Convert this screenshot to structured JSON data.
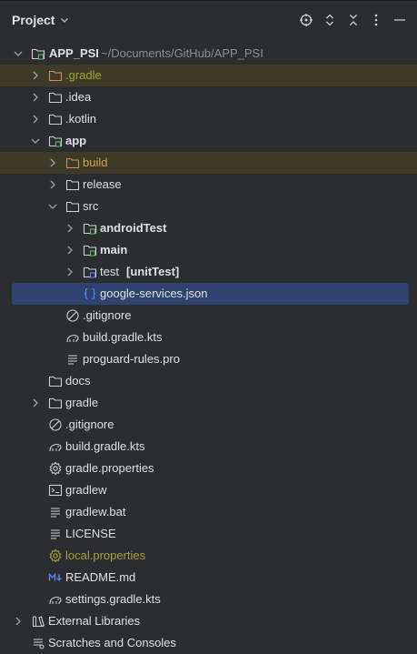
{
  "header": {
    "title": "Project",
    "tools": [
      "target-icon",
      "expand-icon",
      "collapse-icon",
      "more-icon",
      "minimize-icon"
    ]
  },
  "tree": {
    "root": {
      "name": "APP_PSI",
      "path": "~/Documents/GitHub/APP_PSI"
    },
    "gradle_dir": ".gradle",
    "idea_dir": ".idea",
    "kotlin_dir": ".kotlin",
    "app": {
      "name": "app",
      "build": "build",
      "release": "release",
      "src": {
        "name": "src",
        "android_test": "androidTest",
        "main": "main",
        "test": "test",
        "test_tag": "[unitTest]"
      },
      "google_services": "google-services.json",
      "gitignore": ".gitignore",
      "build_gradle": "build.gradle.kts",
      "proguard": "proguard-rules.pro"
    },
    "docs": "docs",
    "gradle": "gradle",
    "gitignore": ".gitignore",
    "build_gradle": "build.gradle.kts",
    "gradle_properties": "gradle.properties",
    "gradlew": "gradlew",
    "gradlew_bat": "gradlew.bat",
    "license": "LICENSE",
    "local_properties": "local.properties",
    "readme": "README.md",
    "settings_gradle": "settings.gradle.kts",
    "external_libraries": "External Libraries",
    "scratches": "Scratches and Consoles"
  },
  "colors": {
    "background": "#2b2d30",
    "selection": "#2e436e",
    "ignored_row": "#3d3b27",
    "ignored_text": "#a6a33b",
    "excluded_text": "#d0a54a"
  }
}
